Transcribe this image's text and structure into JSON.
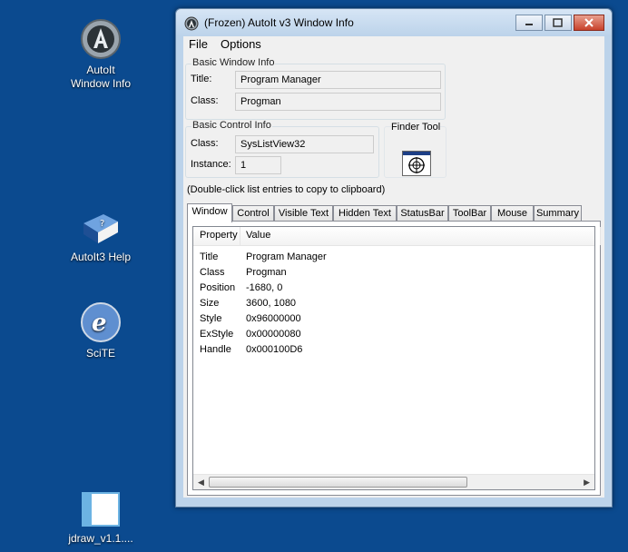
{
  "desktop": {
    "icons": [
      {
        "label_line1": "AutoIt",
        "label_line2": "Window Info",
        "icon": "autoit-logo-icon"
      },
      {
        "label_line1": "AutoIt3 Help",
        "icon": "help-book-icon"
      },
      {
        "label_line1": "SciTE",
        "icon": "scite-icon"
      },
      {
        "label_line1": "jdraw_v1.1....",
        "icon": "jdraw-file-icon"
      }
    ]
  },
  "window": {
    "title": "(Frozen) AutoIt v3 Window Info",
    "menu": [
      "File",
      "Options"
    ],
    "basic_window_info": {
      "legend": "Basic Window Info",
      "title_label": "Title:",
      "title_value": "Program Manager",
      "class_label": "Class:",
      "class_value": "Progman"
    },
    "basic_control_info": {
      "legend": "Basic Control Info",
      "class_label": "Class:",
      "class_value": "SysListView32",
      "instance_label": "Instance:",
      "instance_value": "1"
    },
    "finder_tool": {
      "label": "Finder Tool",
      "icon": "crosshair-target-icon"
    },
    "hint": "(Double-click list entries to copy to clipboard)",
    "tabs": [
      "Window",
      "Control",
      "Visible Text",
      "Hidden Text",
      "StatusBar",
      "ToolBar",
      "Mouse",
      "Summary"
    ],
    "active_tab": "Window",
    "list": {
      "columns": [
        "Property",
        "Value"
      ],
      "rows": [
        {
          "property": "Title",
          "value": "Program Manager"
        },
        {
          "property": "Class",
          "value": "Progman"
        },
        {
          "property": "Position",
          "value": "-1680, 0"
        },
        {
          "property": "Size",
          "value": "3600, 1080"
        },
        {
          "property": "Style",
          "value": "0x96000000"
        },
        {
          "property": "ExStyle",
          "value": "0x00000080"
        },
        {
          "property": "Handle",
          "value": "0x000100D6"
        }
      ]
    }
  }
}
